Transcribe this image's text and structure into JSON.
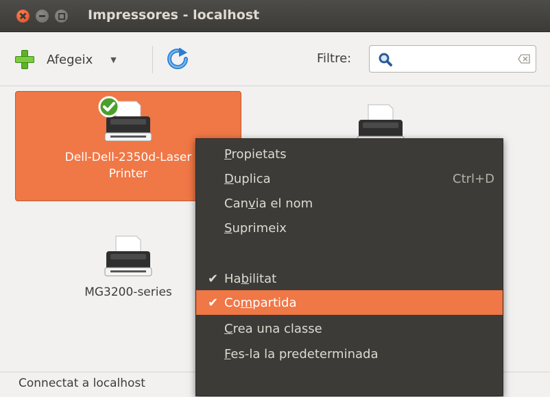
{
  "window": {
    "title": "Impressores - localhost"
  },
  "toolbar": {
    "add_label": "Afegeix",
    "filter_label": "Filtre:",
    "filter_value": ""
  },
  "printers": [
    {
      "name_line1": "Dell-Dell-2350d-Laser",
      "name_line2": "Printer",
      "default": true,
      "selected": true
    },
    {
      "name_line1": "",
      "name_line2": "",
      "default": false,
      "selected": false
    },
    {
      "name_line1": "MG3200-series",
      "name_line2": "",
      "default": false,
      "selected": false
    }
  ],
  "status": {
    "text": "Connectat a localhost"
  },
  "context_menu": {
    "items": [
      {
        "pre": "",
        "mn": "P",
        "post": "ropietats",
        "accel": "",
        "checked": false
      },
      {
        "pre": "",
        "mn": "D",
        "post": "uplica",
        "accel": "Ctrl+D",
        "checked": false
      },
      {
        "pre": "Can",
        "mn": "v",
        "post": "ia el nom",
        "accel": "",
        "checked": false
      },
      {
        "pre": "",
        "mn": "S",
        "post": "uprimeix",
        "accel": "",
        "checked": false
      },
      {
        "pre": "Ha",
        "mn": "b",
        "post": "ilitat",
        "accel": "",
        "checked": true
      },
      {
        "pre": "Co",
        "mn": "m",
        "post": "partida",
        "accel": "",
        "checked": true
      },
      {
        "pre": "",
        "mn": "C",
        "post": "rea una classe",
        "accel": "",
        "checked": false
      },
      {
        "pre": "",
        "mn": "F",
        "post": "es-la la predeterminada",
        "accel": "",
        "checked": false
      }
    ]
  },
  "colors": {
    "accent": "#f07746",
    "titlebar": "#3c3b37",
    "menu_bg": "#3c3b37"
  },
  "icons": [
    "close-icon",
    "minimize-icon",
    "maximize-icon",
    "add-icon",
    "dropdown-arrow-icon",
    "refresh-icon",
    "search-icon",
    "clear-icon",
    "printer-icon",
    "default-check-icon",
    "check-icon"
  ]
}
